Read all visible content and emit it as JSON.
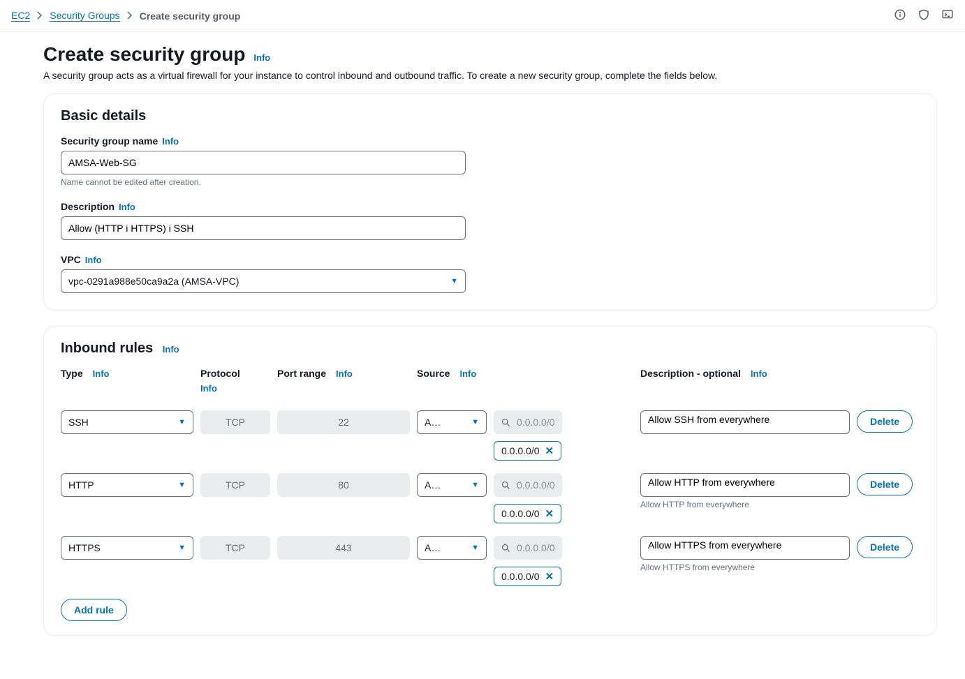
{
  "breadcrumb": {
    "root": "EC2",
    "level1": "Security Groups",
    "current": "Create security group"
  },
  "header": {
    "title": "Create security group",
    "info": "Info",
    "description": "A security group acts as a virtual firewall for your instance to control inbound and outbound traffic. To create a new security group, complete the fields below."
  },
  "basic": {
    "title": "Basic details",
    "name_label": "Security group name",
    "name_info": "Info",
    "name_value": "AMSA-Web-SG",
    "name_hint": "Name cannot be edited after creation.",
    "desc_label": "Description",
    "desc_info": "Info",
    "desc_value": "Allow (HTTP i HTTPS) i SSH",
    "vpc_label": "VPC",
    "vpc_info": "Info",
    "vpc_value": "vpc-0291a988e50ca9a2a (AMSA-VPC)"
  },
  "inbound": {
    "title": "Inbound rules",
    "title_info": "Info",
    "columns": {
      "type": "Type",
      "protocol": "Protocol",
      "port": "Port range",
      "source": "Source",
      "desc": "Description - optional",
      "info": "Info"
    },
    "source_display": "A…",
    "source_placeholder": "0.0.0.0/0",
    "rules": [
      {
        "type": "SSH",
        "protocol": "TCP",
        "port": "22",
        "cidr": "0.0.0.0/0",
        "description": "Allow SSH from everywhere",
        "desc_sub": ""
      },
      {
        "type": "HTTP",
        "protocol": "TCP",
        "port": "80",
        "cidr": "0.0.0.0/0",
        "description": "Allow HTTP from everywhere",
        "desc_sub": "Allow HTTP from everywhere"
      },
      {
        "type": "HTTPS",
        "protocol": "TCP",
        "port": "443",
        "cidr": "0.0.0.0/0",
        "description": "Allow HTTPS from everywhere",
        "desc_sub": "Allow HTTPS from everywhere"
      }
    ],
    "delete_label": "Delete",
    "add_rule_label": "Add rule"
  }
}
